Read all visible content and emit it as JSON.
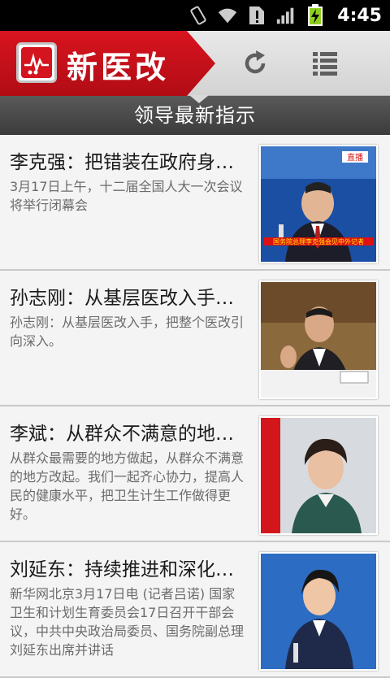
{
  "status": {
    "time": "4:45",
    "icons": [
      "vibrate-icon",
      "wifi-icon",
      "alert-icon",
      "signal-icon",
      "battery-charging-icon"
    ]
  },
  "header": {
    "app_title": "新医改",
    "refresh_icon": "refresh-icon",
    "menu_icon": "list-menu-icon"
  },
  "section": {
    "title": "领导最新指示"
  },
  "articles": [
    {
      "title": "李克强：把错装在政府身…",
      "summary": "3月17日上午，十二届全国人大一次会议将举行闭幕会",
      "thumb_caption": "国务院总理李克强会见中外记者",
      "thumb_badge": "直播"
    },
    {
      "title": "孙志刚：从基层医改入手…",
      "summary": "孙志刚：从基层医改入手，把整个医改引向深入。"
    },
    {
      "title": "李斌：从群众不满意的地…",
      "summary": "从群众最需要的地方做起，从群众不满意的地方改起。我们一起齐心协力，提高人民的健康水平，把卫生计生工作做得更好。"
    },
    {
      "title": "刘延东：持续推进和深化…",
      "summary": "新华网北京3月17日电 (记者吕诺) 国家卫生和计划生育委员会17日召开干部会议，中共中央政治局委员、国务院副总理刘延东出席并讲话"
    }
  ]
}
